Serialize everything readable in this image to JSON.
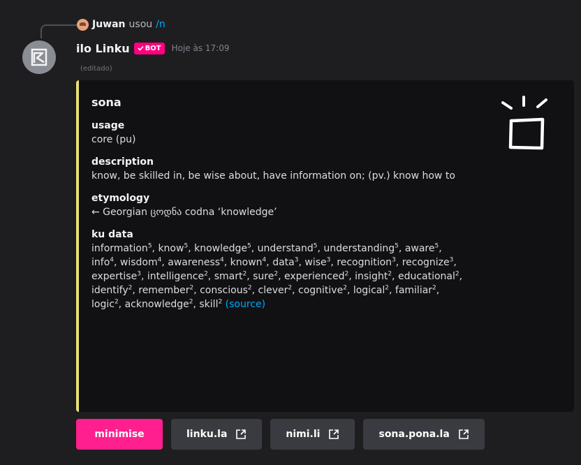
{
  "reply": {
    "user": "Juwan",
    "verb": "usou",
    "command": "/n"
  },
  "message": {
    "username": "ilo Linku",
    "badge": "BOT",
    "timestamp": "Hoje às 17:09",
    "edited": "(editado)"
  },
  "embed": {
    "title": "sona",
    "fields": [
      {
        "name": "usage",
        "value": "core (pu)"
      },
      {
        "name": "description",
        "value": "know, be skilled in, be wise about, have information on; (pv.) know how to"
      },
      {
        "name": "etymology",
        "value": "← Georgian ცოდნა codna ‘knowledge’"
      }
    ],
    "ku_data": {
      "name": "ku data",
      "items": [
        {
          "word": "information",
          "n": "5"
        },
        {
          "word": "know",
          "n": "5"
        },
        {
          "word": "knowledge",
          "n": "5"
        },
        {
          "word": "understand",
          "n": "5"
        },
        {
          "word": "understanding",
          "n": "5"
        },
        {
          "word": "aware",
          "n": "5"
        },
        {
          "word": "info",
          "n": "4"
        },
        {
          "word": "wisdom",
          "n": "4"
        },
        {
          "word": "awareness",
          "n": "4"
        },
        {
          "word": "known",
          "n": "4"
        },
        {
          "word": "data",
          "n": "3"
        },
        {
          "word": "wise",
          "n": "3"
        },
        {
          "word": "recognition",
          "n": "3"
        },
        {
          "word": "recognize",
          "n": "3"
        },
        {
          "word": "expertise",
          "n": "3"
        },
        {
          "word": "intelligence",
          "n": "2"
        },
        {
          "word": "smart",
          "n": "2"
        },
        {
          "word": "sure",
          "n": "2"
        },
        {
          "word": "experienced",
          "n": "2"
        },
        {
          "word": "insight",
          "n": "2"
        },
        {
          "word": "educational",
          "n": "2"
        },
        {
          "word": "identify",
          "n": "2"
        },
        {
          "word": "remember",
          "n": "2"
        },
        {
          "word": "conscious",
          "n": "2"
        },
        {
          "word": "clever",
          "n": "2"
        },
        {
          "word": "cognitive",
          "n": "2"
        },
        {
          "word": "logical",
          "n": "2"
        },
        {
          "word": "familiar",
          "n": "2"
        },
        {
          "word": "logic",
          "n": "2"
        },
        {
          "word": "acknowledge",
          "n": "2"
        },
        {
          "word": "skill",
          "n": "2"
        }
      ],
      "source_label": "(source)"
    },
    "accent_color": "#e8e076"
  },
  "buttons": [
    {
      "label": "minimise",
      "style": "primary"
    },
    {
      "label": "linku.la",
      "icon": "external-link-icon"
    },
    {
      "label": "nimi.li",
      "icon": "external-link-icon"
    },
    {
      "label": "sona.pona.la",
      "icon": "external-link-icon"
    }
  ],
  "colors": {
    "background": "#1e1e20",
    "embed_bg": "#111113",
    "primary_button": "#ff1f8e",
    "link": "#00a8fc"
  }
}
